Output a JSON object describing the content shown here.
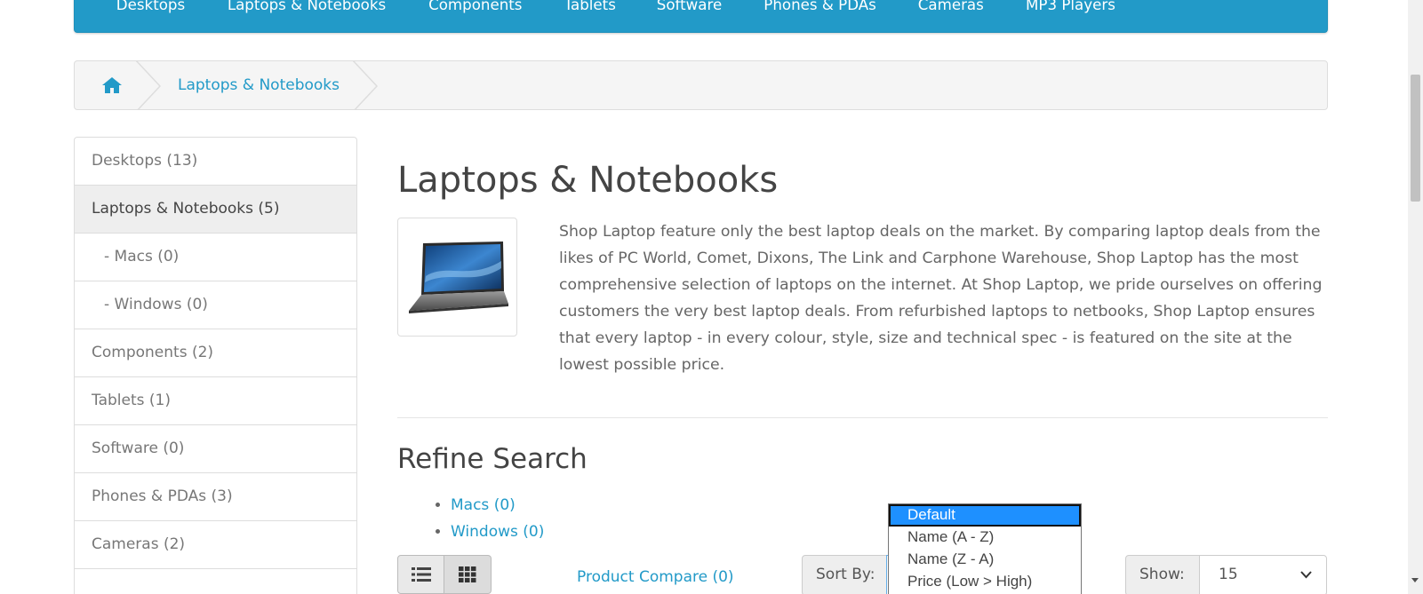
{
  "top_menu": {
    "items": [
      {
        "label": "Desktops"
      },
      {
        "label": "Laptops & Notebooks"
      },
      {
        "label": "Components"
      },
      {
        "label": "Tablets"
      },
      {
        "label": "Software"
      },
      {
        "label": "Phones & PDAs"
      },
      {
        "label": "Cameras"
      },
      {
        "label": "MP3 Players"
      }
    ]
  },
  "breadcrumb": {
    "home_icon": "home-icon",
    "current": "Laptops & Notebooks"
  },
  "sidebar": {
    "items": [
      {
        "label": "Desktops (13)"
      },
      {
        "label": "Laptops & Notebooks (5)"
      },
      {
        "label": "- Macs (0)"
      },
      {
        "label": "- Windows (0)"
      },
      {
        "label": "Components (2)"
      },
      {
        "label": "Tablets (1)"
      },
      {
        "label": "Software (0)"
      },
      {
        "label": "Phones & PDAs (3)"
      },
      {
        "label": "Cameras (2)"
      }
    ]
  },
  "category": {
    "title": "Laptops & Notebooks",
    "image_icon": "laptop-image",
    "description": "Shop Laptop feature only the best laptop deals on the market. By comparing laptop deals from the likes of PC World, Comet, Dixons, The Link and Carphone Warehouse, Shop Laptop has the most comprehensive selection of laptops on the internet. At Shop Laptop, we pride ourselves on offering customers the very best laptop deals. From refurbished laptops to netbooks, Shop Laptop ensures that every laptop - in every colour, style, size and technical spec - is featured on the site at the lowest possible price."
  },
  "refine": {
    "title": "Refine Search",
    "links": [
      {
        "label": "Macs (0)"
      },
      {
        "label": "Windows (0)"
      }
    ]
  },
  "toolbar": {
    "list_view_icon": "list-view-icon",
    "grid_view_icon": "grid-view-icon",
    "compare_label": "Product Compare (0)",
    "sort_label": "Sort By:",
    "sort_options": [
      {
        "label": "Default"
      },
      {
        "label": "Name (A - Z)"
      },
      {
        "label": "Name (Z - A)"
      },
      {
        "label": "Price (Low > High)"
      }
    ],
    "show_label": "Show:",
    "show_value": "15"
  },
  "colors": {
    "accent": "#229ac8",
    "selected_option": "#1e90ff"
  }
}
